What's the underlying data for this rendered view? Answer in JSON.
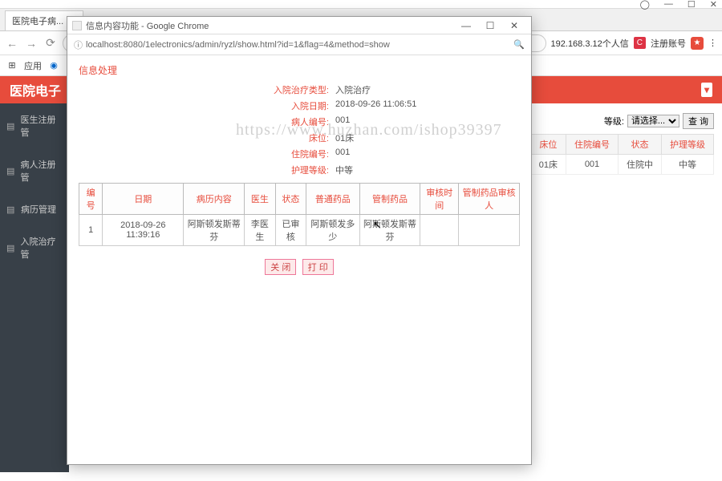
{
  "main_window": {
    "controls": {
      "min": "—",
      "max": "☐",
      "close": "✕"
    },
    "avatar": "◯",
    "tab_active": "医院电子病...",
    "nav": {
      "back": "←",
      "fwd": "→",
      "reload": "⟳"
    },
    "addr_text": "192.168.3.12个人信",
    "reg_label": "注册账号",
    "bookmarks": {
      "apps": "应用"
    }
  },
  "app": {
    "title": "医院电子",
    "user_icon": "▾"
  },
  "sidebar": {
    "items": [
      {
        "icon": "▤",
        "label": "医生注册管"
      },
      {
        "icon": "▤",
        "label": "病人注册管"
      },
      {
        "icon": "▤",
        "label": "病历管理"
      },
      {
        "icon": "▤",
        "label": "入院治疗管"
      }
    ]
  },
  "filter": {
    "label": "等级:",
    "select_placeholder": "请选择...",
    "btn": "查 询"
  },
  "main_table": {
    "headers": [
      "床位",
      "住院编号",
      "状态",
      "护理等级"
    ],
    "row": [
      "01床",
      "001",
      "住院中",
      "中等"
    ]
  },
  "popup": {
    "title": "信息内容功能 - Google Chrome",
    "controls": {
      "min": "—",
      "max": "☐",
      "close": "✕"
    },
    "url": "localhost:8080/1electronics/admin/ryzl/show.html?id=1&flag=4&method=show",
    "info_title": "信息处理",
    "fields": [
      {
        "label": "入院治疗类型:",
        "value": "入院治疗"
      },
      {
        "label": "入院日期:",
        "value": "2018-09-26 11:06:51"
      },
      {
        "label": "病人编号:",
        "value": "001"
      },
      {
        "label": "床位:",
        "value": "01床"
      },
      {
        "label": "住院编号:",
        "value": "001"
      },
      {
        "label": "护理等级:",
        "value": "中等"
      }
    ],
    "record_headers": [
      "编号",
      "日期",
      "病历内容",
      "医生",
      "状态",
      "普通药品",
      "管制药品",
      "审核时间",
      "管制药品审核人"
    ],
    "record_row": [
      "1",
      "2018-09-26 11:39:16",
      "阿斯顿发斯蒂芬",
      "李医生",
      "已审核",
      "阿斯顿发多少",
      "阿斯顿发斯蒂芬",
      "",
      ""
    ],
    "btn_close": "关 闭",
    "btn_print": "打 印"
  },
  "watermark": "https://www.huzhan.com/ishop39397"
}
